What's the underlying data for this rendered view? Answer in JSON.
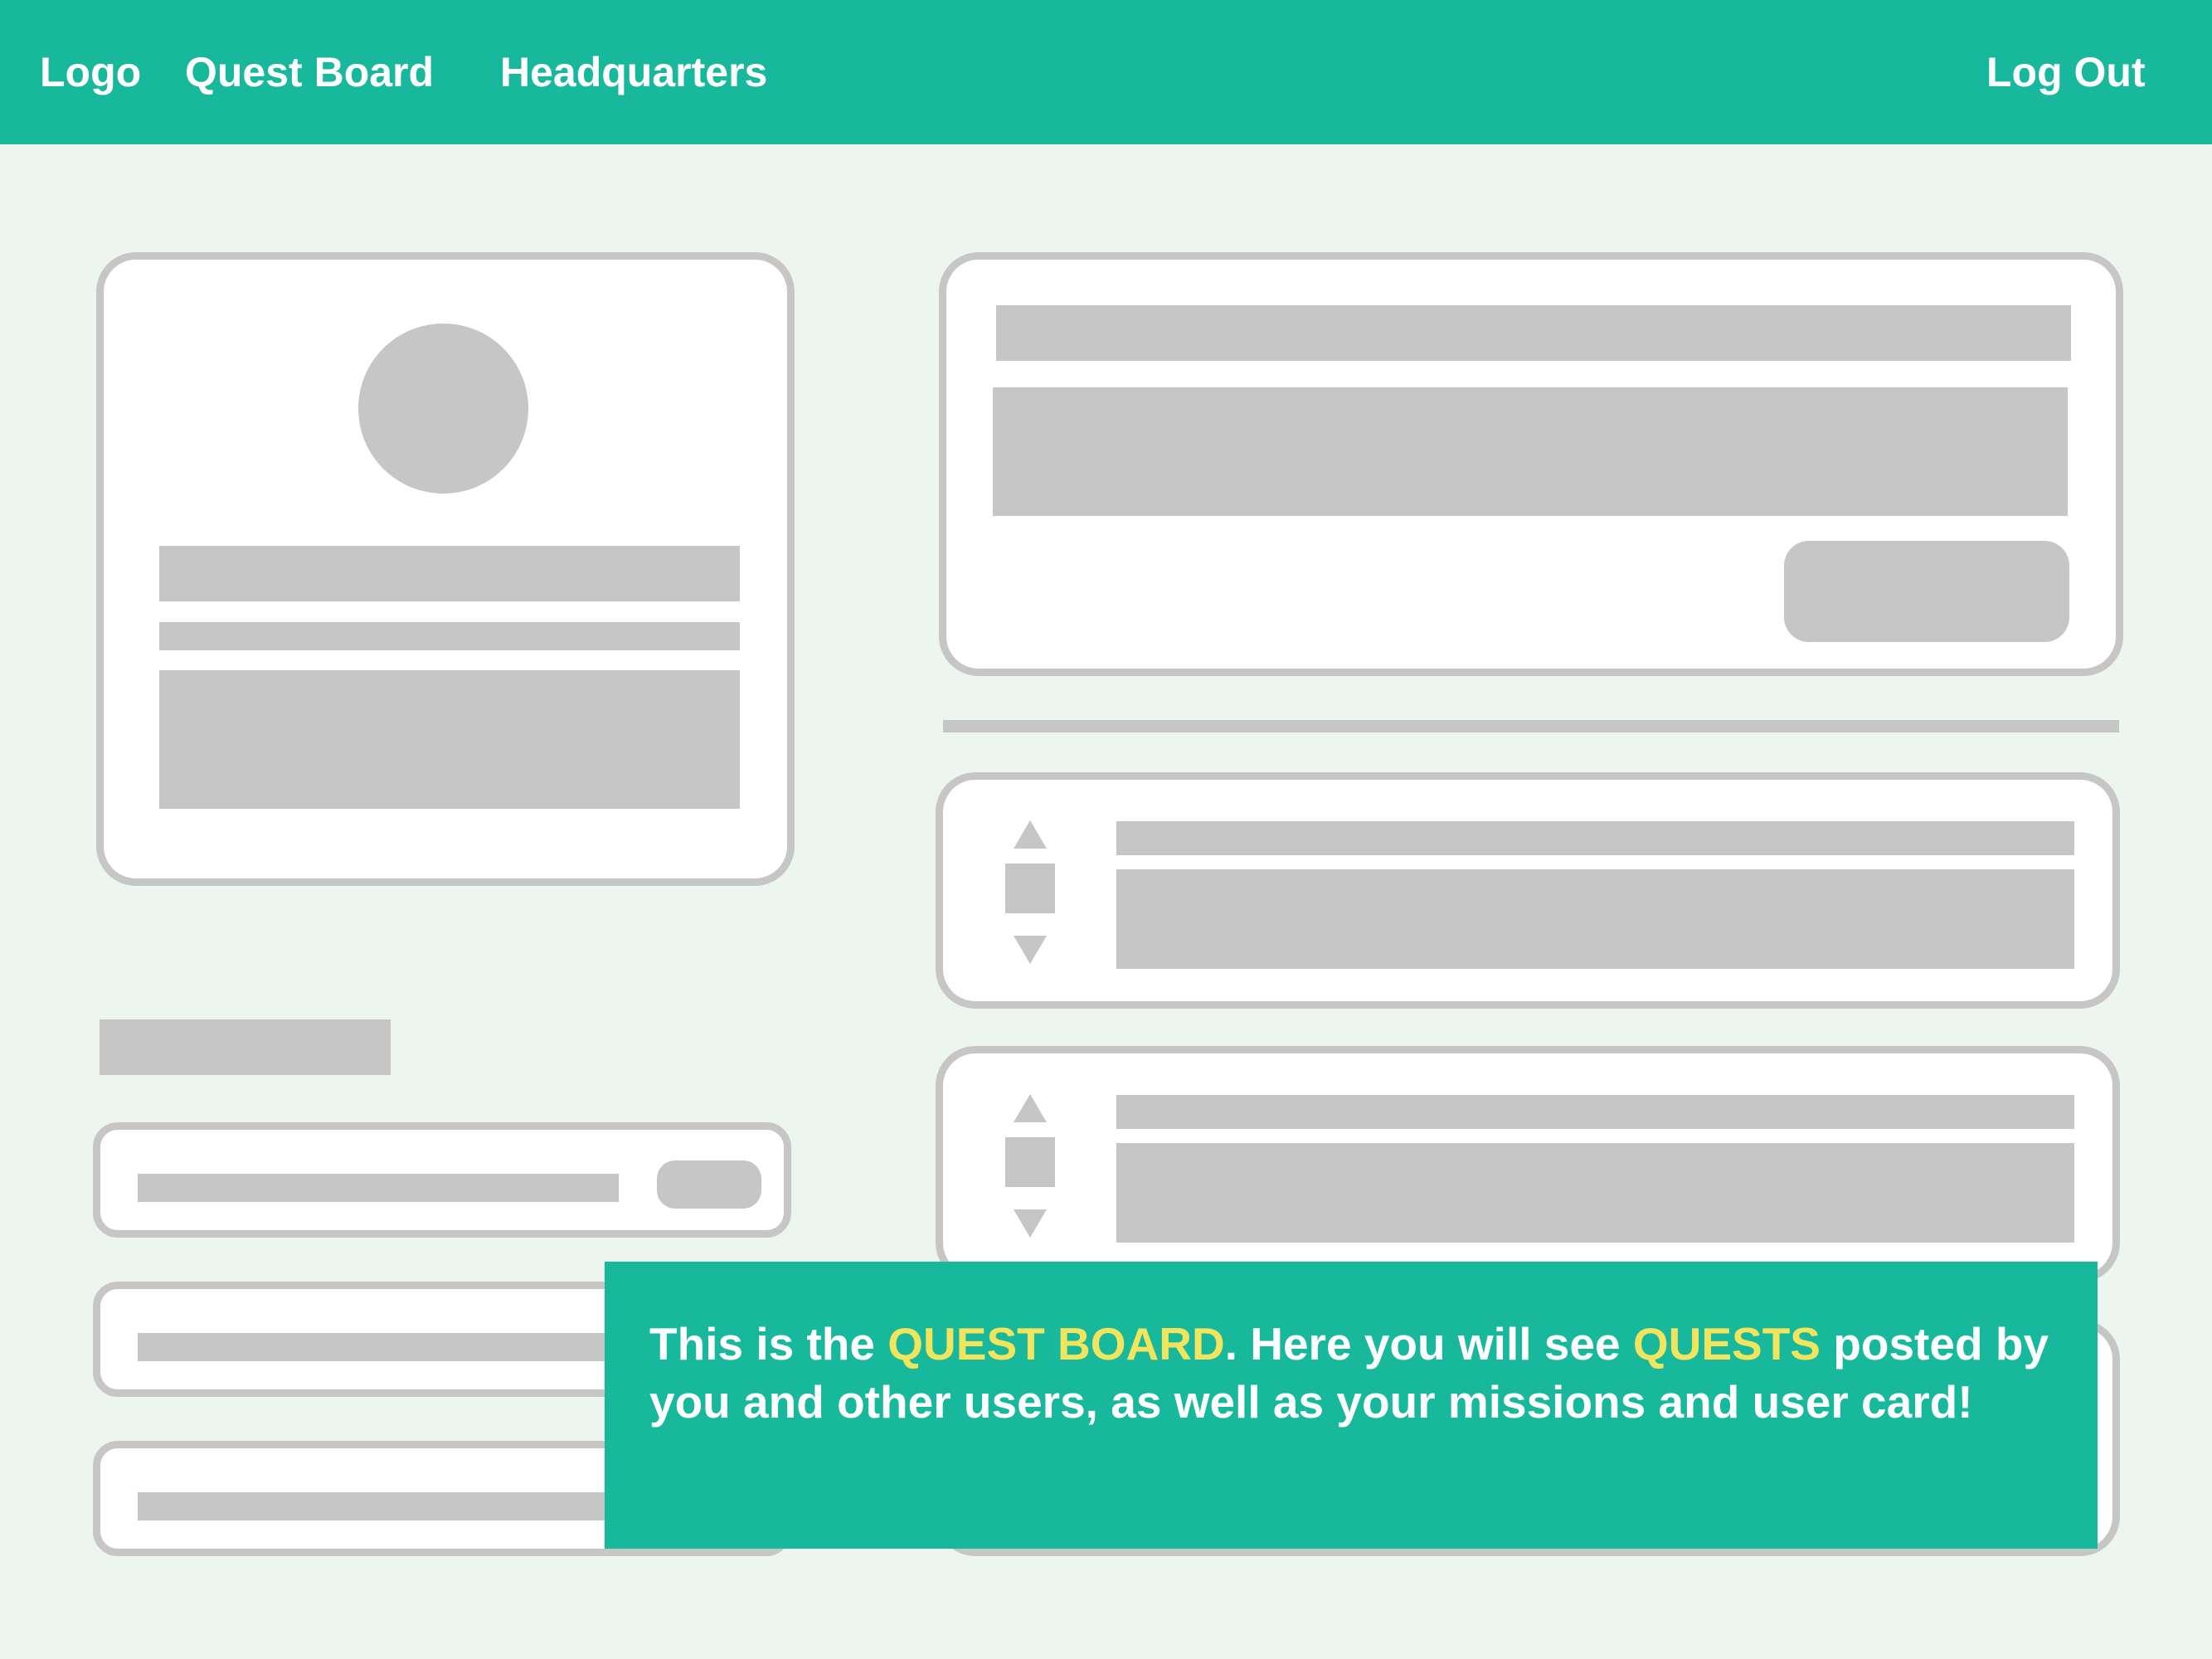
{
  "nav": {
    "logo": "Logo",
    "quest_board": "Quest Board",
    "headquarters": "Headquarters",
    "log_out": "Log Out"
  },
  "tooltip": {
    "part1": "This is the ",
    "highlight1": "QUEST BOARD",
    "part2": ". Here you will see ",
    "highlight2": "QUESTS",
    "part3": " posted by you and other users, as well as your missions and user card!"
  },
  "colors": {
    "accent": "#18B89C",
    "highlight": "#F2E45C",
    "background": "#EDF6EE",
    "placeholder": "#C6C6C6"
  },
  "icons": [
    "avatar-placeholder",
    "upvote-arrow-icon",
    "downvote-arrow-icon",
    "vote-count-placeholder"
  ]
}
